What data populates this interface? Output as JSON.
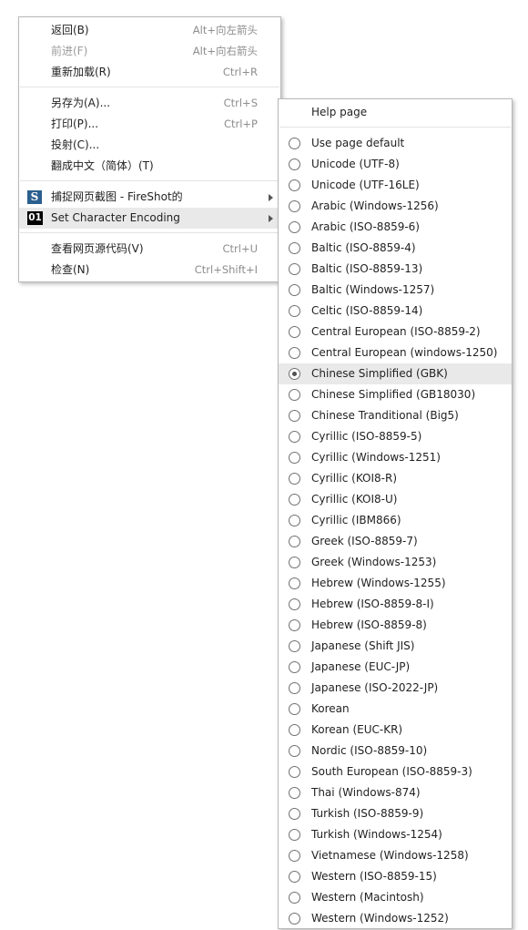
{
  "context_menu": {
    "items": [
      {
        "label": "返回(B)",
        "shortcut": "Alt+向左箭头"
      },
      {
        "label": "前进(F)",
        "shortcut": "Alt+向右箭头",
        "disabled": true
      },
      {
        "label": "重新加载(R)",
        "shortcut": "Ctrl+R"
      },
      {
        "label": "另存为(A)...",
        "shortcut": "Ctrl+S"
      },
      {
        "label": "打印(P)...",
        "shortcut": "Ctrl+P"
      },
      {
        "label": "投射(C)...",
        "shortcut": ""
      },
      {
        "label": "翻成中文（简体）(T)",
        "shortcut": ""
      },
      {
        "label": "捕捉网页截图 - FireShot的",
        "icon_text": "S"
      },
      {
        "label": "Set Character Encoding",
        "icon_text": "01"
      },
      {
        "label": "查看网页源代码(V)",
        "shortcut": "Ctrl+U"
      },
      {
        "label": "检查(N)",
        "shortcut": "Ctrl+Shift+I"
      }
    ]
  },
  "encoding_menu": {
    "help_label": "Help page",
    "selected": "Chinese Simplified (GBK)",
    "items": [
      "Use page default",
      "Unicode (UTF-8)",
      "Unicode (UTF-16LE)",
      "Arabic (Windows-1256)",
      "Arabic (ISO-8859-6)",
      "Baltic (ISO-8859-4)",
      "Baltic (ISO-8859-13)",
      "Baltic (Windows-1257)",
      "Celtic (ISO-8859-14)",
      "Central European (ISO-8859-2)",
      "Central European (windows-1250)",
      "Chinese Simplified (GBK)",
      "Chinese Simplified (GB18030)",
      "Chinese Trandi­tional (Big5)",
      "Cyrillic (ISO-8859-5)",
      "Cyrillic (Windows-1251)",
      "Cyrillic (KOI8-R)",
      "Cyrillic (KOI8-U)",
      "Cyrillic (IBM866)",
      "Greek (ISO-8859-7)",
      "Greek (Windows-1253)",
      "Hebrew (Windows-1255)",
      "Hebrew (ISO-8859-8-I)",
      "Hebrew (ISO-8859-8)",
      "Japanese (Shift JIS)",
      "Japanese (EUC-JP)",
      "Japanese (ISO-2022-JP)",
      "Korean",
      "Korean (EUC-KR)",
      "Nordic (ISO-8859-10)",
      "South European (ISO-8859-3)",
      "Thai (Windows-874)",
      "Turkish (ISO-8859-9)",
      "Turkish (Windows-1254)",
      "Vietnamese (Windows-1258)",
      "Western (ISO-8859-15)",
      "Western (Macintosh)",
      "Western (Windows-1252)"
    ]
  }
}
